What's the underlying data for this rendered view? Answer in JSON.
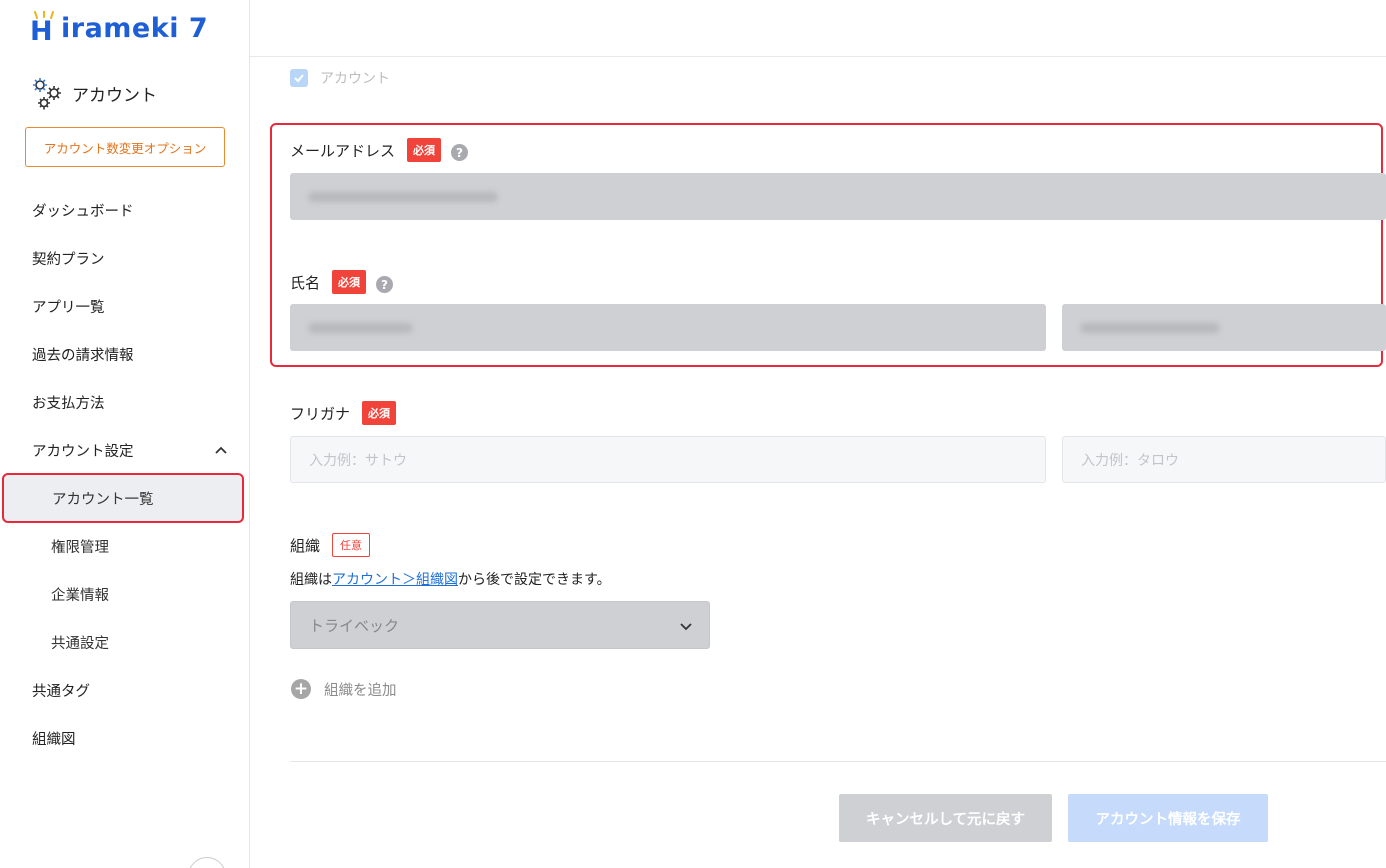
{
  "brand": {
    "logo_text": "irameki 7",
    "logo_initial": "H"
  },
  "sidebar": {
    "section_title": "アカウント",
    "option_button": "アカウント数変更オプション",
    "items": [
      {
        "label": "ダッシュボード"
      },
      {
        "label": "契約プラン"
      },
      {
        "label": "アプリ一覧"
      },
      {
        "label": "過去の請求情報"
      },
      {
        "label": "お支払方法"
      },
      {
        "label": "アカウント設定"
      }
    ],
    "sub_items": [
      {
        "label": "アカウント一覧"
      },
      {
        "label": "権限管理"
      },
      {
        "label": "企業情報"
      },
      {
        "label": "共通設定"
      }
    ],
    "bottom_items": [
      {
        "label": "共通タグ"
      },
      {
        "label": "組織図"
      }
    ]
  },
  "form": {
    "account_checkbox_label": "アカウント",
    "email": {
      "label": "メールアドレス",
      "badge": "必須",
      "help": "?"
    },
    "name": {
      "label": "氏名",
      "badge": "必須",
      "help": "?"
    },
    "furigana": {
      "label": "フリガナ",
      "badge": "必須",
      "last_placeholder": "入力例：サトウ",
      "first_placeholder": "入力例：タロウ"
    },
    "organization": {
      "label": "組織",
      "badge": "任意",
      "note_prefix": "組織は",
      "note_link": "アカウント＞組織図",
      "note_suffix": "から後で設定できます。",
      "selected": "トライベック",
      "add_label": "組織を追加"
    }
  },
  "actions": {
    "cancel": "キャンセルして元に戻す",
    "save": "アカウント情報を保存"
  },
  "colors": {
    "brand": "#1f5fd6",
    "required": "#f0433a",
    "highlight": "#e8283b",
    "option_button": "#e5731c"
  }
}
